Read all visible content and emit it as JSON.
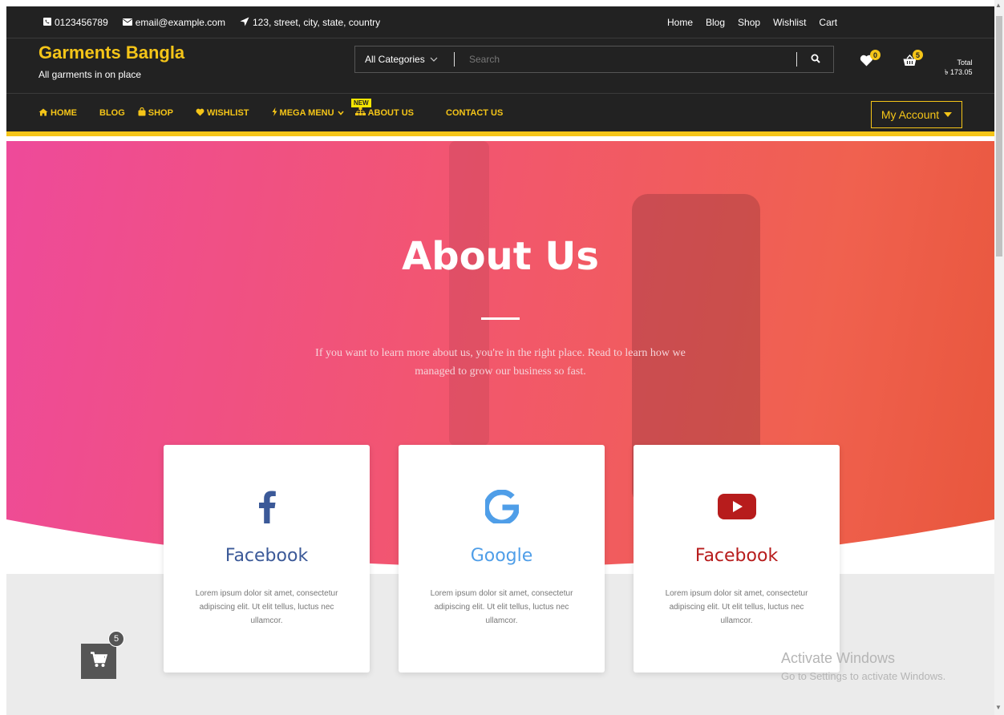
{
  "topbar": {
    "phone": "0123456789",
    "email": "email@example.com",
    "address": "123, street, city, state, country",
    "links": [
      "Home",
      "Blog",
      "Shop",
      "Wishlist",
      "Cart"
    ]
  },
  "header": {
    "brand_title": "Garments Bangla",
    "brand_subtitle": "All garments in on place",
    "category_label": "All Categories",
    "search_placeholder": "Search",
    "wishlist_count": "0",
    "cart_count": "5",
    "total_label": "Total",
    "total_value": "৳ 173.05"
  },
  "nav": {
    "items": [
      "HOME",
      "BLOG",
      "SHOP",
      "WISHLIST",
      "MEGA MENU",
      "ABOUT US",
      "CONTACT US"
    ],
    "new_badge": "NEW",
    "account_label": "My Account"
  },
  "hero": {
    "title": "About Us",
    "description": "If you want to learn more about us, you're in the right place. Read to learn how we managed to grow our business so fast."
  },
  "cards": [
    {
      "title": "Facebook",
      "text": "Lorem ipsum dolor sit amet, consectetur adipiscing elit. Ut elit tellus, luctus nec ullamcor.",
      "color": "#3b5998",
      "icon": "facebook-icon"
    },
    {
      "title": "Google",
      "text": "Lorem ipsum dolor sit amet, consectetur adipiscing elit. Ut elit tellus, luctus nec ullamcor.",
      "color": "#4f9ee8",
      "icon": "google-icon"
    },
    {
      "title": "Facebook",
      "text": "Lorem ipsum dolor sit amet, consectetur adipiscing elit. Ut elit tellus, luctus nec ullamcor.",
      "color": "#b71c1c",
      "icon": "youtube-icon"
    }
  ],
  "floating_cart": {
    "count": "5"
  },
  "watermark": {
    "line1": "Activate Windows",
    "line2": "Go to Settings to activate Windows."
  },
  "colors": {
    "accent": "#f5c518",
    "dark": "#222222"
  }
}
